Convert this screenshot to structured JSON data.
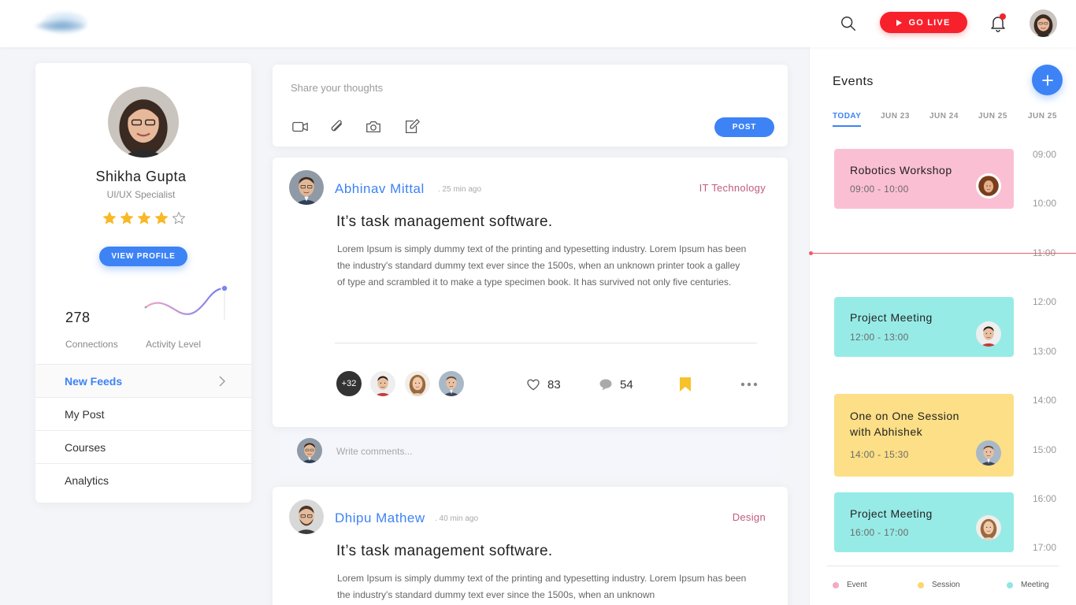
{
  "header": {
    "go_live_label": "GO LIVE"
  },
  "profile": {
    "name": "Shikha Gupta",
    "role": "UI/UX Specialist",
    "rating": 4,
    "rating_max": 5,
    "view_profile_label": "VIEW PROFILE",
    "connections_count": "278",
    "connections_label": "Connections",
    "activity_label": "Activity Level"
  },
  "menu": {
    "items": [
      {
        "label": "New Feeds",
        "active": true
      },
      {
        "label": "My Post"
      },
      {
        "label": "Courses"
      },
      {
        "label": "Analytics"
      }
    ]
  },
  "composer": {
    "placeholder": "Share your thoughts",
    "post_label": "POST",
    "icons": [
      "video-icon",
      "attachment-icon",
      "camera-icon",
      "edit-icon"
    ]
  },
  "posts": [
    {
      "author": "Abhinav Mittal",
      "time": ". 25 min ago",
      "category": "IT Technology",
      "title": "It’s task management software.",
      "body": "Lorem Ipsum is simply dummy text of the printing and typesetting industry. Lorem Ipsum has been the industry's standard dummy text ever since the 1500s, when an unknown printer took a galley of type and scrambled it to make a type specimen book. It has survived not only five centuries.",
      "likers_more": "+32",
      "likes": "83",
      "comments": "54"
    },
    {
      "author": "Dhipu Mathew",
      "time": ". 40 min ago",
      "category": "Design",
      "title": "It’s task management software.",
      "body": "Lorem Ipsum is simply dummy text of the printing and typesetting industry. Lorem Ipsum has been the industry's standard dummy text ever since the 1500s, when an unknown"
    }
  ],
  "comment": {
    "placeholder": "Write comments..."
  },
  "events": {
    "title": "Events",
    "tabs": [
      {
        "label": "TODAY",
        "active": true
      },
      {
        "label": "JUN 23"
      },
      {
        "label": "JUN 24"
      },
      {
        "label": "JUN 25"
      },
      {
        "label": "JUN 25"
      }
    ],
    "times": [
      "09:00",
      "10:00",
      "11:00",
      "12:00",
      "13:00",
      "14:00",
      "15:00",
      "16:00",
      "17:00"
    ],
    "cards": [
      {
        "name": "Robotics Workshop",
        "time": "09:00 - 10:00",
        "type": "Event"
      },
      {
        "name": "Project Meeting",
        "time": "12:00 - 13:00",
        "type": "Meeting"
      },
      {
        "name": "One on One Session with Abhishek",
        "time": "14:00 - 15:30",
        "type": "Session"
      },
      {
        "name": "Project Meeting",
        "time": "16:00 - 17:00",
        "type": "Meeting"
      }
    ],
    "legend": [
      {
        "label": "Event",
        "color": "#f7a8c3"
      },
      {
        "label": "Session",
        "color": "#fcd66f"
      },
      {
        "label": "Meeting",
        "color": "#8fe6e4"
      }
    ]
  },
  "colors": {
    "accent": "#3d83f5",
    "live": "#f7212c",
    "category": "#c25b7e",
    "event_pink": "#fbbfd4",
    "meeting_teal": "#97ebe7",
    "session_yellow": "#fcdf86",
    "bookmark": "#f7c22a"
  }
}
